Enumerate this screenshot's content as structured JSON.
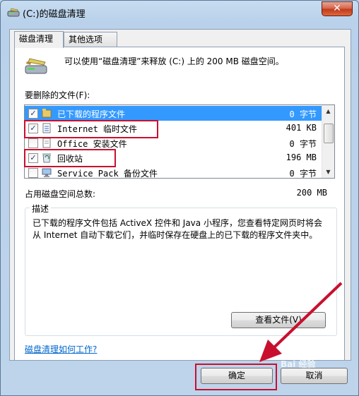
{
  "window": {
    "title": "(C:)的磁盘清理",
    "close_glyph": "✕"
  },
  "tabs": [
    {
      "label": "磁盘清理",
      "active": true
    },
    {
      "label": "其他选项",
      "active": false
    }
  ],
  "intro_text": "可以使用“磁盘清理”来释放 (C:) 上的 200 MB 磁盘空间。",
  "files_label": "要删除的文件(F):",
  "files": [
    {
      "name": "已下载的程序文件",
      "size": "0 字节",
      "checked": true,
      "selected": true
    },
    {
      "name": "Internet 临时文件",
      "size": "401 KB",
      "checked": true,
      "selected": false
    },
    {
      "name": "Office 安装文件",
      "size": "0 字节",
      "checked": false,
      "selected": false
    },
    {
      "name": "回收站",
      "size": "196 MB",
      "checked": true,
      "selected": false
    },
    {
      "name": "Service Pack 备份文件",
      "size": "0 字节",
      "checked": false,
      "selected": false
    }
  ],
  "check_glyph": "✓",
  "total": {
    "label": "占用磁盘空间总数:",
    "value": "200 MB"
  },
  "description": {
    "legend": "描述",
    "text": "已下载的程序文件包括 ActiveX 控件和 Java 小程序，您查看特定网页时将会从 Internet 自动下载它们，并临时保存在硬盘上的已下载的程序文件夹中。"
  },
  "view_files_button": "查看文件(V)",
  "help_link": "磁盘清理如何工作?",
  "ok_button": "确定",
  "cancel_button": "取消",
  "watermark": "Bai  经验",
  "colors": {
    "selection": "#3399ff",
    "annotation_red": "#c8102e",
    "link": "#0066cc"
  }
}
